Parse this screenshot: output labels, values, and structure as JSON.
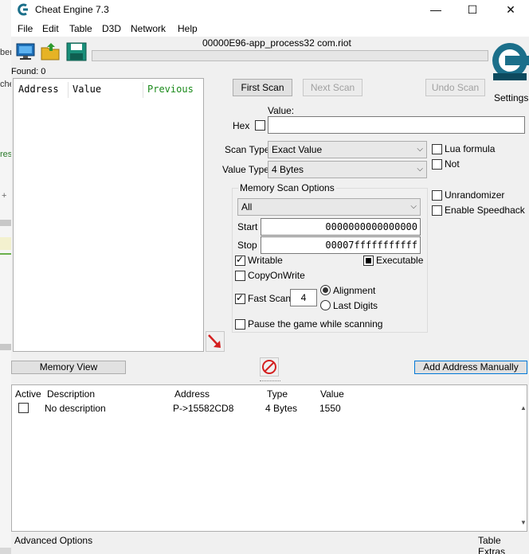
{
  "title": "Cheat Engine 7.3",
  "window_controls": {
    "minimize": "—",
    "maximize": "☐",
    "close": "✕"
  },
  "menu": [
    "File",
    "Edit",
    "Table",
    "D3D",
    "Network",
    "Help"
  ],
  "process_name": "00000E96-app_process32 com.riot",
  "settings_label": "Settings",
  "found_label": "Found: 0",
  "result_columns": [
    "Address",
    "Value",
    "Previous"
  ],
  "buttons": {
    "first_scan": "First Scan",
    "next_scan": "Next Scan",
    "undo_scan": "Undo Scan",
    "memory_view": "Memory View",
    "add_address_manually": "Add Address Manually"
  },
  "scan": {
    "value_label": "Value:",
    "hex_label": "Hex",
    "value": "",
    "scan_type_label": "Scan Type",
    "scan_type": "Exact Value",
    "value_type_label": "Value Type",
    "value_type": "4 Bytes",
    "lua_formula": "Lua formula",
    "not_label": "Not",
    "unrandomizer": "Unrandomizer",
    "enable_speedhack": "Enable Speedhack"
  },
  "memory_scan_options": {
    "legend": "Memory Scan Options",
    "region": "All",
    "start_label": "Start",
    "start": "0000000000000000",
    "stop_label": "Stop",
    "stop": "00007fffffffffff",
    "writable": "Writable",
    "executable": "Executable",
    "copy_on_write": "CopyOnWrite",
    "fast_scan": "Fast Scan",
    "fast_scan_value": "4",
    "alignment": "Alignment",
    "last_digits": "Last Digits",
    "pause_game": "Pause the game while scanning"
  },
  "address_table": {
    "columns": [
      "Active",
      "Description",
      "Address",
      "Type",
      "Value"
    ],
    "rows": [
      {
        "active": false,
        "description": "No description",
        "address": "P->15582CD8",
        "type": "4 Bytes",
        "value": "1550"
      }
    ]
  },
  "status": {
    "left": "Advanced Options",
    "right": "Table Extras"
  },
  "background_fragments": [
    "ber",
    "che",
    "res",
    "+"
  ]
}
